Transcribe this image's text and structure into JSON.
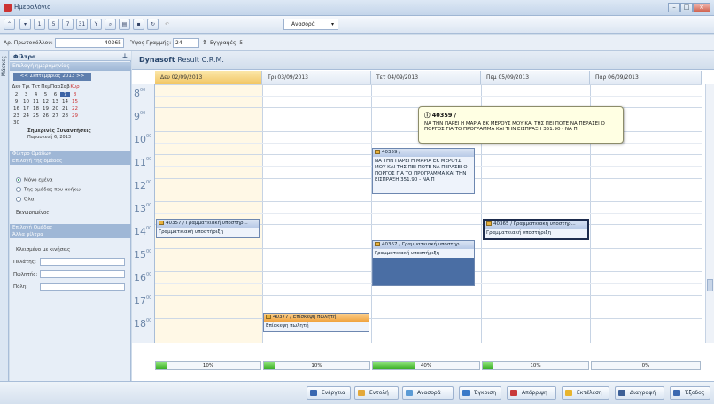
{
  "window": {
    "title": "Ημερολόγιο"
  },
  "toolbar": {
    "view_select": "Ανασορά",
    "nums": [
      "1",
      "5",
      "7",
      "31",
      "Y"
    ]
  },
  "infobar": {
    "protocol_label": "Αρ. Πρωτοκόλλου:",
    "protocol_value": "40365",
    "row_height_label": "Ύψος Γραμμής:",
    "row_height_value": "24",
    "records_label": "Εγγραφές: 5"
  },
  "sidebar": {
    "vertical_tab": "Μάσκες",
    "filters_title": "Φίλτρα",
    "date_group": "Επιλογή ημερομηνίας",
    "month_nav": "<< Σεπτέμβριος 2013 >>",
    "weekdays": [
      "Δευ",
      "Τρι",
      "Τετ",
      "Πεμ",
      "Παρ",
      "Σαβ",
      "Κυρ"
    ],
    "cal_rows": [
      [
        "2",
        "3",
        "4",
        "5",
        "6",
        "7",
        "8"
      ],
      [
        "9",
        "10",
        "11",
        "12",
        "13",
        "14",
        "15"
      ],
      [
        "16",
        "17",
        "18",
        "19",
        "20",
        "21",
        "22"
      ],
      [
        "23",
        "24",
        "25",
        "26",
        "27",
        "28",
        "29"
      ],
      [
        "30",
        "",
        "",
        "",
        "",
        "",
        ""
      ]
    ],
    "pending_text": "Σημερινές Συναντήσεις",
    "pending_date": "Παρασκευή 6, 2013",
    "group_filter": "Φίλτρο Ομάδων",
    "user_groups": "Επιλογή της ομάδας",
    "radio_options": [
      "Μόνο εμένα",
      "Της ομάδας που ανήκω",
      "Όλα"
    ],
    "assigned_label": "Εκχωρημένος",
    "group_select": "Επιλογή Ομάδας",
    "other_filters": "Άλλα φίλτρα",
    "check_label": "Κλεισμένο με κινήσεις",
    "fields": [
      "Πελάτης:",
      "Πωλητής:",
      "Πόλη:"
    ]
  },
  "main": {
    "brand": "Dynasoft",
    "brand_sub": "Result C.R.M.",
    "days": [
      "Δευ 02/09/2013",
      "Τρι 03/09/2013",
      "Τετ 04/09/2013",
      "Πεμ 05/09/2013",
      "Παρ 06/09/2013"
    ],
    "hours": [
      "8",
      "9",
      "10",
      "11",
      "12",
      "13",
      "14",
      "15",
      "16",
      "17",
      "18"
    ],
    "hour_min": "00",
    "appointments": [
      {
        "title": "40357 / Γραμματειακή υποστηρ...",
        "body": "Γραμματειακή υποστήριξη"
      },
      {
        "title": "40359 /",
        "body": "ΝΑ ΤΗΝ ΠΑΡΕΙ Η ΜΑΡΙΑ ΕΚ ΜΕΡΟΥΣ ΜΟΥ ΚΑΙ ΤΗΣ ΠΕΙ ΠΟΤΕ ΝΑ ΠΕΡΑΣΕΙ Ο ΠΟΡΓΟΣ ΓΙΑ ΤΟ ΠΡΟΓΡΑΜΜΑ ΚΑΙ ΤΗΝ ΕΙΣΠΡΑΞΗ 351.90 - ΝΑ Π"
      },
      {
        "title": "40367 / Γραμματειακή υποστηρ...",
        "body": "Γραμματειακή υποστήριξη"
      },
      {
        "title": "40365 / Γραμματειακή υποστηρ...",
        "body": "Γραμματειακή υποστήριξη"
      },
      {
        "title": "40377 / Επίσκεψη πωλητή",
        "body": "Επίσκεψη πωλητή"
      }
    ],
    "tooltip": {
      "title": "40359 /",
      "text": "ΝΑ ΤΗΝ ΠΑΡΕΙ Η ΜΑΡΙΑ ΕΚ ΜΕΡΟΥΣ ΜΟΥ ΚΑΙ ΤΗΣ ΠΕΙ ΠΟΤΕ ΝΑ ΠΕΡΑΣΕΙ Ο ΠΟΡΓΟΣ ΓΙΑ ΤΟ ΠΡΟΓΡΑΜΜΑ ΚΑΙ ΤΗΝ ΕΙΣΠΡΑΞΗ 351.90 - ΝΑ Π"
    },
    "progress": [
      {
        "label": "10%",
        "value": 0.1
      },
      {
        "label": "10%",
        "value": 0.1
      },
      {
        "label": "40%",
        "value": 0.4
      },
      {
        "label": "10%",
        "value": 0.1
      },
      {
        "label": "0%",
        "value": 0
      }
    ]
  },
  "bottombar": {
    "buttons": [
      "Ενέργεια",
      "Εντολή",
      "Ανασορά",
      "Έγκριση",
      "Απόρριψη",
      "Εκτέλεση",
      "Διαγραφή",
      "Έξοδος"
    ]
  }
}
